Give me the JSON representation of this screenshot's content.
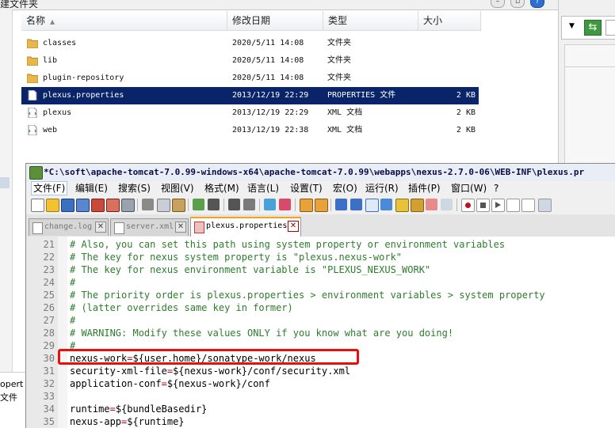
{
  "explorer": {
    "title_partial": "建文件夹",
    "columns": [
      {
        "label": "名称"
      },
      {
        "label": "修改日期"
      },
      {
        "label": "类型"
      },
      {
        "label": "大小"
      }
    ],
    "files": [
      {
        "name": "classes",
        "date": "2020/5/11 14:08",
        "type": "文件夹",
        "size": "",
        "icon": "folder-icon"
      },
      {
        "name": "lib",
        "date": "2020/5/11 14:08",
        "type": "文件夹",
        "size": "",
        "icon": "folder-icon"
      },
      {
        "name": "plugin-repository",
        "date": "2020/5/11 14:08",
        "type": "文件夹",
        "size": "",
        "icon": "folder-icon"
      },
      {
        "name": "plexus.properties",
        "date": "2013/12/19 22:29",
        "type": "PROPERTIES 文件",
        "size": "2 KB",
        "icon": "file-icon",
        "selected": true
      },
      {
        "name": "plexus",
        "date": "2013/12/19 22:29",
        "type": "XML 文档",
        "size": "2 KB",
        "icon": "xml-file-icon"
      },
      {
        "name": "web",
        "date": "2013/12/19 22:38",
        "type": "XML 文档",
        "size": "2 KB",
        "icon": "xml-file-icon"
      }
    ],
    "left_bottom": {
      "line1": "opert",
      "line2": "文件"
    },
    "selection_color": "#0a246a"
  },
  "npp": {
    "title": "*C:\\soft\\apache-tomcat-7.0.99-windows-x64\\apache-tomcat-7.0.99\\webapps\\nexus-2.7.0-06\\WEB-INF\\plexus.pr",
    "menu": [
      {
        "label": "文件(F)"
      },
      {
        "label": "编辑(E)"
      },
      {
        "label": "搜索(S)"
      },
      {
        "label": "视图(V)"
      },
      {
        "label": "格式(M)"
      },
      {
        "label": "语言(L)"
      },
      {
        "label": "设置(T)"
      },
      {
        "label": "宏(O)"
      },
      {
        "label": "运行(R)"
      },
      {
        "label": "插件(P)"
      },
      {
        "label": "窗口(W)"
      },
      {
        "label": "?"
      }
    ],
    "tabs": [
      {
        "label": "change.log"
      },
      {
        "label": "server.xml"
      },
      {
        "label": "plexus.properties",
        "active": true
      }
    ],
    "lines": [
      {
        "num": "21",
        "type": "comment",
        "text": "# Also, you can set this path using system property or environment variables"
      },
      {
        "num": "22",
        "type": "comment",
        "text": "# The key for nexus system property is \"plexus.nexus-work\""
      },
      {
        "num": "23",
        "type": "comment",
        "text": "# The key for nexus environment variable is \"PLEXUS_NEXUS_WORK\""
      },
      {
        "num": "24",
        "type": "comment",
        "text": "#"
      },
      {
        "num": "25",
        "type": "comment",
        "text": "# The priority order is plexus.properties > environment variables > system property"
      },
      {
        "num": "26",
        "type": "comment",
        "text": "# (latter overrides same key in former)"
      },
      {
        "num": "27",
        "type": "comment",
        "text": "#"
      },
      {
        "num": "28",
        "type": "comment",
        "text": "# WARNING: Modify these values ONLY if you know what are you doing!"
      },
      {
        "num": "29",
        "type": "comment",
        "text": "#"
      },
      {
        "num": "30",
        "type": "kv",
        "key": "nexus-work",
        "value": "${user.home}/sonatype-work/nexus"
      },
      {
        "num": "31",
        "type": "kv",
        "key": "security-xml-file",
        "value": "${nexus-work}/conf/security.xml"
      },
      {
        "num": "32",
        "type": "kv",
        "key": "application-conf",
        "value": "${nexus-work}/conf"
      },
      {
        "num": "33",
        "type": "blank",
        "text": ""
      },
      {
        "num": "34",
        "type": "kv",
        "key": "runtime",
        "value": "${bundleBasedir}"
      },
      {
        "num": "35",
        "type": "kv",
        "key": "nexus-app",
        "value": "${runtime}"
      }
    ],
    "highlight_color": "#e8100c",
    "comment_color": "#2d7d2d"
  }
}
